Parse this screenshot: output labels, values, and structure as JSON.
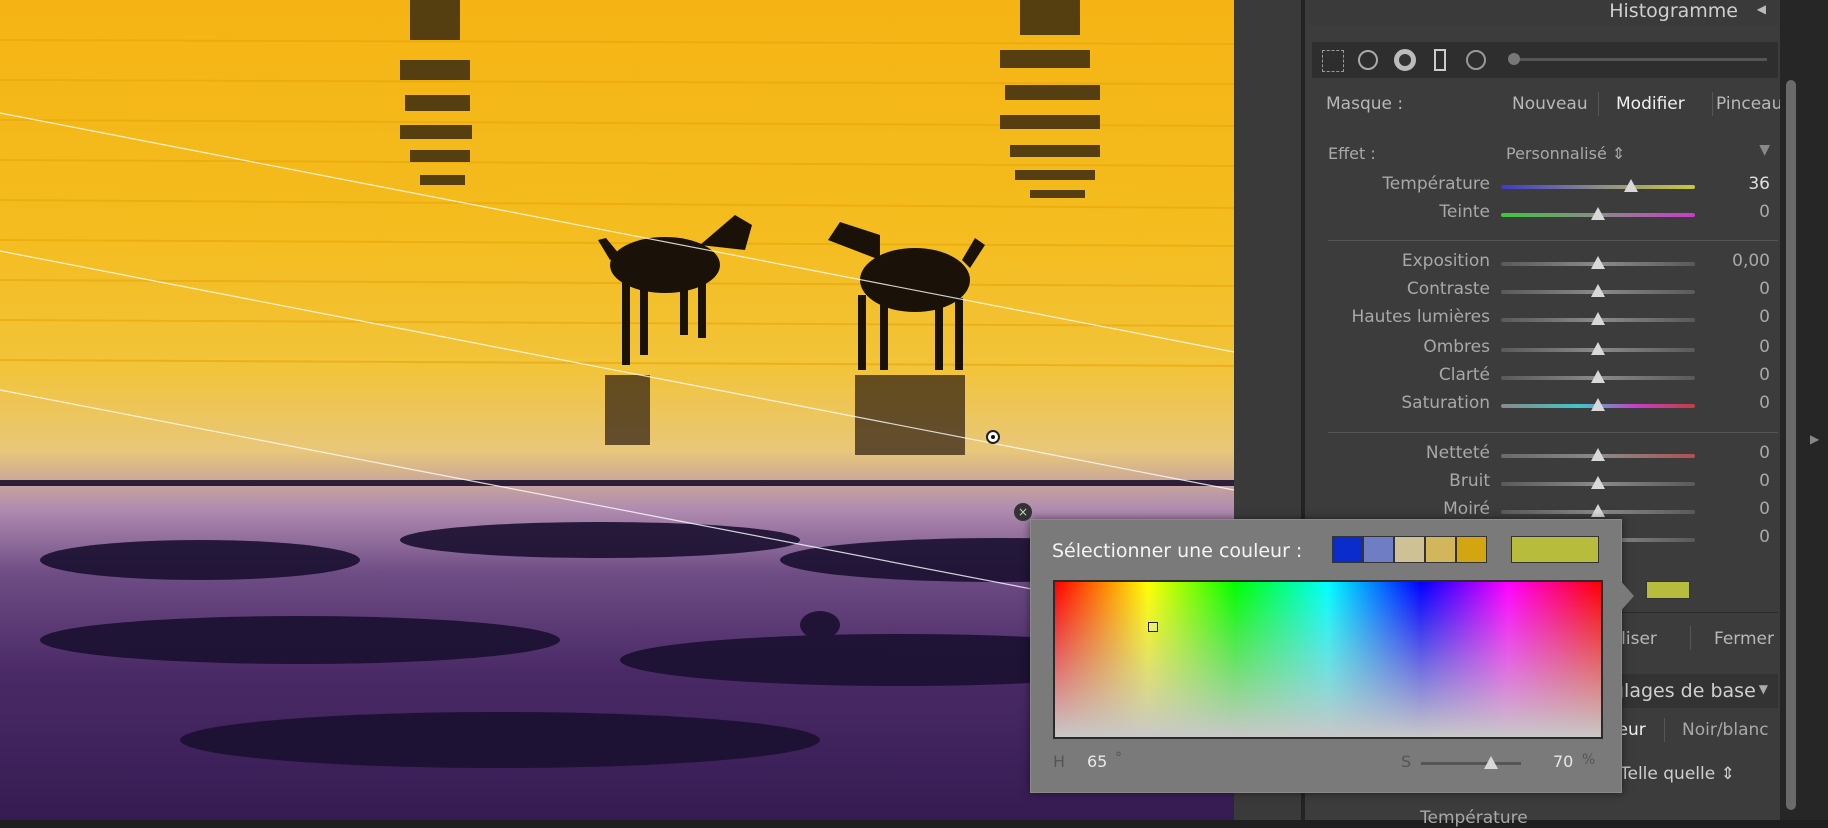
{
  "panel": {
    "histogram_title": "Histogramme",
    "mask": {
      "label": "Masque :",
      "new": "Nouveau",
      "edit": "Modifier",
      "brush": "Pinceau"
    },
    "effect": {
      "label": "Effet :",
      "preset": "Personnalisé"
    },
    "sliders": [
      {
        "label": "Température",
        "value": "36",
        "pos": 0.67,
        "track": "temp"
      },
      {
        "label": "Teinte",
        "value": "0",
        "pos": 0.5,
        "track": "tint"
      },
      {
        "label": "Exposition",
        "value": "0,00",
        "pos": 0.5,
        "track": "gray"
      },
      {
        "label": "Contraste",
        "value": "0",
        "pos": 0.5,
        "track": "gray"
      },
      {
        "label": "Hautes lumières",
        "value": "0",
        "pos": 0.5,
        "track": "gray"
      },
      {
        "label": "Ombres",
        "value": "0",
        "pos": 0.5,
        "track": "gray"
      },
      {
        "label": "Clarté",
        "value": "0",
        "pos": 0.5,
        "track": "gray"
      },
      {
        "label": "Saturation",
        "value": "0",
        "pos": 0.5,
        "track": "sat"
      },
      {
        "label": "Netteté",
        "value": "0",
        "pos": 0.5,
        "track": "sharp"
      },
      {
        "label": "Bruit",
        "value": "0",
        "pos": 0.5,
        "track": "gray"
      },
      {
        "label": "Moiré",
        "value": "0",
        "pos": 0.5,
        "track": "gray"
      },
      {
        "label": "",
        "value": "0",
        "pos": 0.5,
        "track": "gray"
      }
    ],
    "color_swatch": "#b8bc3c",
    "buttons": {
      "reset": "ialiser",
      "close": "Fermer"
    },
    "basic_section": "glages de base",
    "treatment": {
      "color": "uleur",
      "bw": "Noir/blanc"
    },
    "profile": "Telle quelle",
    "bottom_label": "Température"
  },
  "picker": {
    "title": "Sélectionner une couleur :",
    "presets": [
      "#0a2ccc",
      "#6f7dc4",
      "#cfc196",
      "#d1b65c",
      "#d3a510"
    ],
    "current": "#b8bc3c",
    "h_label": "H",
    "h_value": "65",
    "h_unit": "°",
    "s_label": "S",
    "s_value": "70",
    "s_unit": "%",
    "s_fraction": 0.7
  },
  "tools": [
    "grid-icon",
    "spot-icon",
    "radial-icon",
    "brush-icon",
    "circle-icon"
  ]
}
